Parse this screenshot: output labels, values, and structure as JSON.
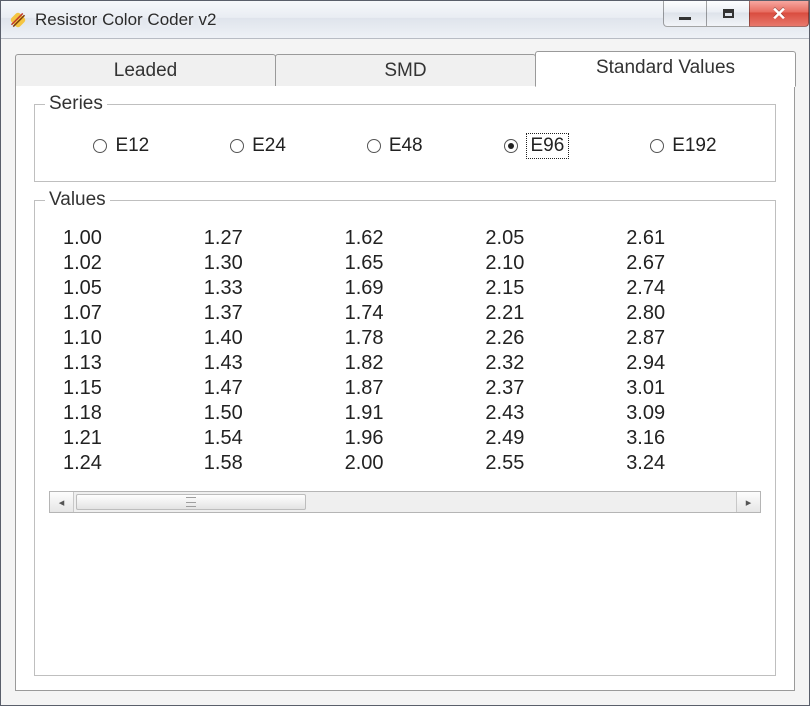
{
  "window": {
    "title": "Resistor Color Coder v2"
  },
  "tabs": [
    {
      "id": "leaded",
      "label": "Leaded",
      "active": false
    },
    {
      "id": "smd",
      "label": "SMD",
      "active": false
    },
    {
      "id": "standard",
      "label": "Standard Values",
      "active": true
    }
  ],
  "series_group": {
    "legend": "Series",
    "options": [
      {
        "id": "e12",
        "label": "E12",
        "checked": false
      },
      {
        "id": "e24",
        "label": "E24",
        "checked": false
      },
      {
        "id": "e48",
        "label": "E48",
        "checked": false
      },
      {
        "id": "e96",
        "label": "E96",
        "checked": true
      },
      {
        "id": "e192",
        "label": "E192",
        "checked": false
      }
    ]
  },
  "values_group": {
    "legend": "Values",
    "columns": [
      [
        "1.00",
        "1.02",
        "1.05",
        "1.07",
        "1.10",
        "1.13",
        "1.15",
        "1.18",
        "1.21",
        "1.24"
      ],
      [
        "1.27",
        "1.30",
        "1.33",
        "1.37",
        "1.40",
        "1.43",
        "1.47",
        "1.50",
        "1.54",
        "1.58"
      ],
      [
        "1.62",
        "1.65",
        "1.69",
        "1.74",
        "1.78",
        "1.82",
        "1.87",
        "1.91",
        "1.96",
        "2.00"
      ],
      [
        "2.05",
        "2.10",
        "2.15",
        "2.21",
        "2.26",
        "2.32",
        "2.37",
        "2.43",
        "2.49",
        "2.55"
      ],
      [
        "2.61",
        "2.67",
        "2.74",
        "2.80",
        "2.87",
        "2.94",
        "3.01",
        "3.09",
        "3.16",
        "3.24"
      ]
    ]
  }
}
